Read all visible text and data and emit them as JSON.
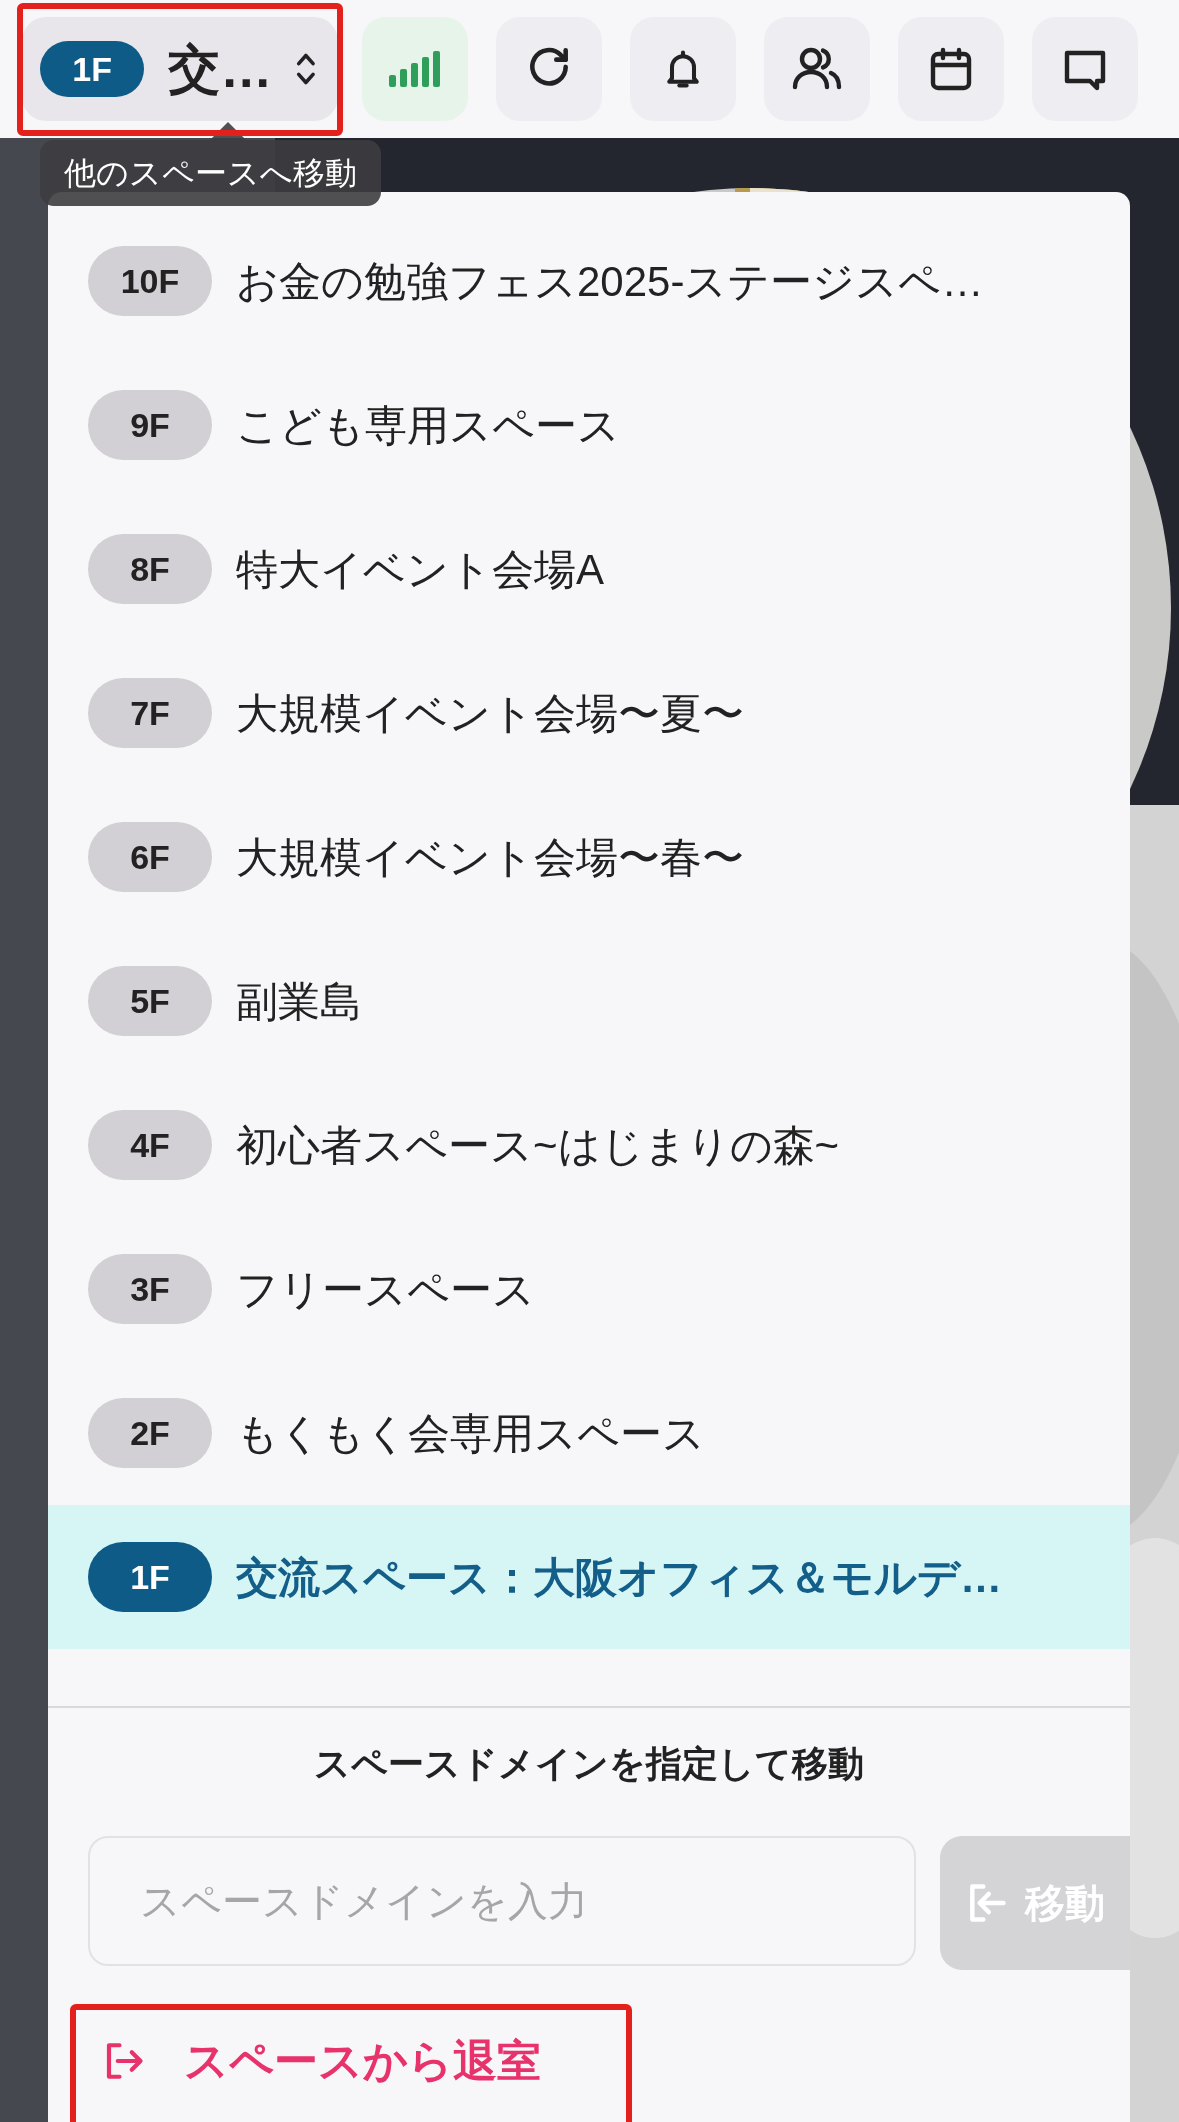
{
  "top_bar": {
    "space_selector": {
      "floor": "1F",
      "name": "交…"
    },
    "tooltip": "他のスペースへ移動"
  },
  "space_menu": {
    "items": [
      {
        "floor": "10F",
        "name": "お金の勉強フェス2025-ステージスペ…",
        "selected": false
      },
      {
        "floor": "9F",
        "name": "こども専用スペース",
        "selected": false
      },
      {
        "floor": "8F",
        "name": "特大イベント会場A",
        "selected": false
      },
      {
        "floor": "7F",
        "name": "大規模イベント会場〜夏〜",
        "selected": false
      },
      {
        "floor": "6F",
        "name": "大規模イベント会場〜春〜",
        "selected": false
      },
      {
        "floor": "5F",
        "name": "副業島",
        "selected": false
      },
      {
        "floor": "4F",
        "name": "初心者スペース~はじまりの森~",
        "selected": false
      },
      {
        "floor": "3F",
        "name": "フリースペース",
        "selected": false
      },
      {
        "floor": "2F",
        "name": "もくもく会専用スペース",
        "selected": false
      },
      {
        "floor": "1F",
        "name": "交流スペース：大阪オフィス＆モルデ…",
        "selected": true
      }
    ],
    "domain_heading": "スペースドメインを指定して移動",
    "domain_input": {
      "placeholder": "スペースドメインを入力"
    },
    "move_button": {
      "label": "移動",
      "disabled": true
    },
    "leave_link": "スペースから退室"
  }
}
